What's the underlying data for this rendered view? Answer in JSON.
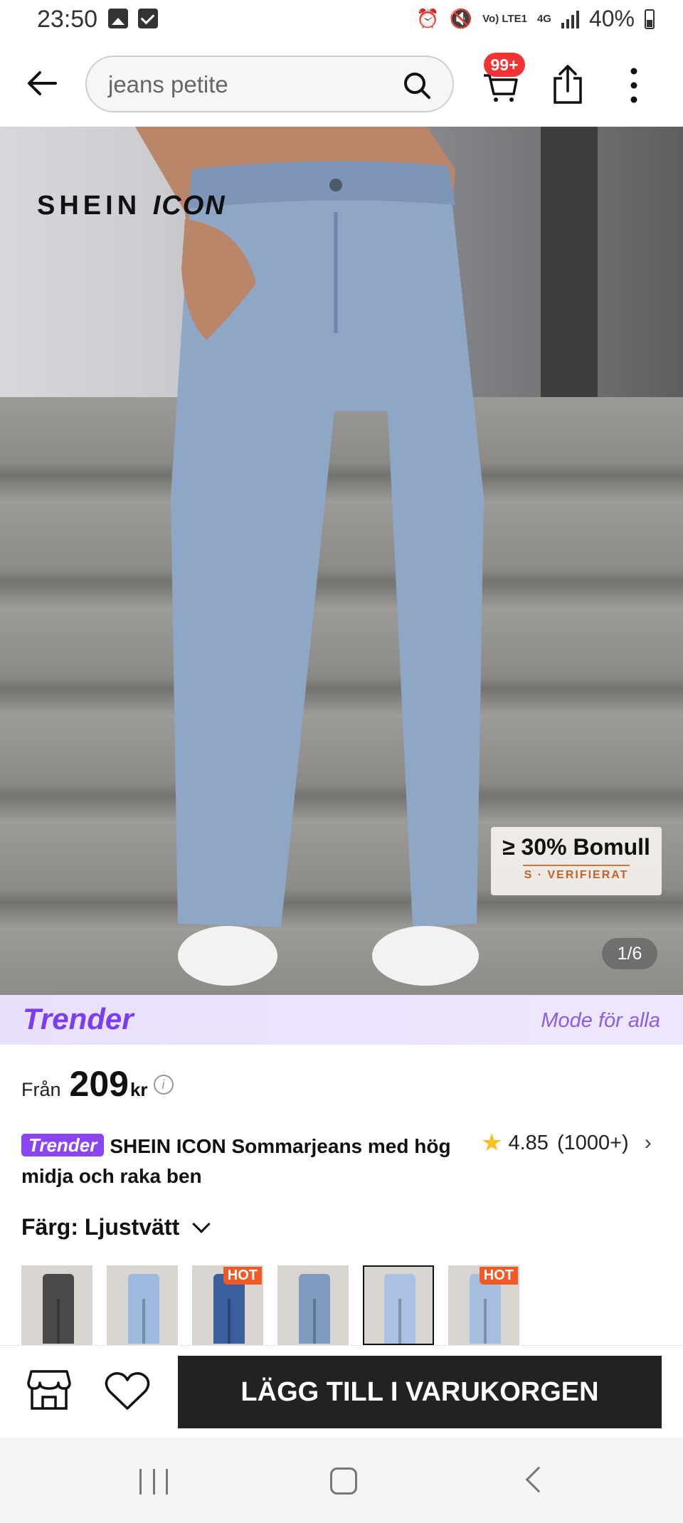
{
  "status_bar": {
    "time": "23:50",
    "network_top": "Vo) LTE1",
    "network_4g": "4G",
    "battery": "40%"
  },
  "header": {
    "search_value": "jeans petite",
    "cart_badge": "99+"
  },
  "hero": {
    "brand": "SHEIN",
    "brand_suffix": "ICON",
    "cotton_badge": "≥ 30% Bomull",
    "cotton_verified": "S · VERIFIERAT",
    "page_indicator": "1/6"
  },
  "trender_banner": {
    "logo": "Trender",
    "tagline": "Mode för alla"
  },
  "price": {
    "from_label": "Från",
    "value": "209",
    "currency": "kr"
  },
  "product": {
    "badge": "Trender",
    "title": "SHEIN ICON Sommarjeans med hög midja och raka ben",
    "rating": "4.85",
    "rating_count": "(1000+)"
  },
  "color": {
    "label": "Färg: Ljustvätt",
    "swatches": [
      {
        "color": "#4a4a4a",
        "hot": false
      },
      {
        "color": "#9db9dd",
        "hot": false
      },
      {
        "color": "#3a5f9c",
        "hot": true
      },
      {
        "color": "#7f9cc0",
        "hot": false
      },
      {
        "color": "#a9c2e3",
        "hot": false,
        "selected": true
      },
      {
        "color": "#a6bfe0",
        "hot": true
      }
    ],
    "hot_label": "HOT"
  },
  "actions": {
    "add_to_cart": "LÄGG TILL I VARUKORGEN"
  },
  "colors": {
    "accent_purple": "#8a45f0",
    "hot_orange": "#f05a24",
    "badge_red": "#f23333",
    "cta_dark": "#222222"
  }
}
